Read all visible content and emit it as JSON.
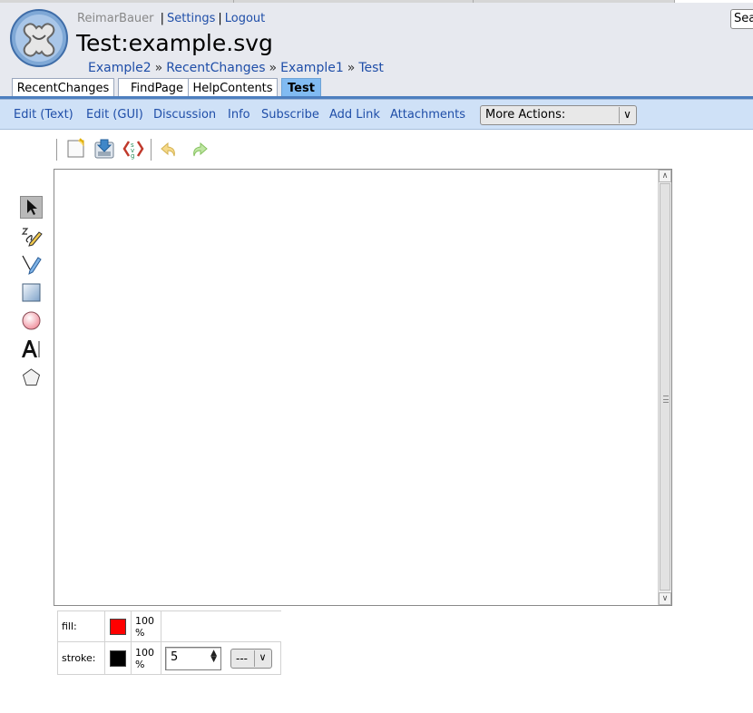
{
  "user": {
    "name": "ReimarBauer",
    "separator": "|",
    "settings": "Settings",
    "logout": "Logout"
  },
  "search": {
    "value": "Sea"
  },
  "page_title": "Test:example.svg",
  "breadcrumbs": {
    "items": [
      "Example2",
      "RecentChanges",
      "Example1",
      "Test"
    ],
    "separator": "»"
  },
  "navtabs": [
    "RecentChanges",
    "FindPage",
    "HelpContents",
    "Test"
  ],
  "actions": [
    "Edit (Text)",
    "Edit (GUI)",
    "Discussion",
    "Info",
    "Subscribe",
    "Add Link",
    "Attachments"
  ],
  "more_actions": {
    "selected": "More Actions:"
  },
  "editor_toolbar": [
    "new-image-icon",
    "save-icon",
    "svg-source-icon",
    "undo-icon",
    "redo-icon"
  ],
  "tools": [
    "select-tool-icon",
    "freehand-pencil-icon",
    "path-pen-icon",
    "rectangle-tool-icon",
    "ellipse-tool-icon",
    "text-tool-icon",
    "polygon-tool-icon"
  ],
  "palette": {
    "fill": {
      "label": "fill:",
      "color": "#ff0000",
      "opacity": "100 %"
    },
    "stroke": {
      "label": "stroke:",
      "color": "#000000",
      "opacity": "100 %",
      "width": "5",
      "dash": "---"
    }
  }
}
